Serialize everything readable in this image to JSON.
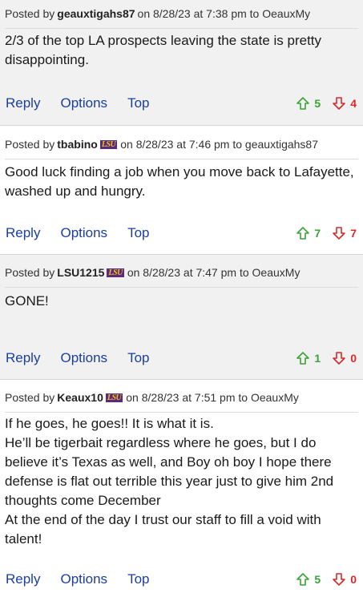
{
  "labels": {
    "posted_by": "Posted by",
    "on": "on",
    "to": "to"
  },
  "posts": [
    {
      "user": "geauxtigahs87",
      "badge": "",
      "date": "8/28/23",
      "time": "at 7:38 pm",
      "to_user": "OeauxMy",
      "lines": [
        "2/3 of the top LA prospects leaving the state is pretty disappointing."
      ],
      "reply": "Reply",
      "options": "Options",
      "top": "Top",
      "upvotes": "5",
      "downvotes": "4"
    },
    {
      "user": "tbabino",
      "badge": "LSU",
      "date": "8/28/23",
      "time": "at 7:46 pm",
      "to_user": "geauxtigahs87",
      "lines": [
        "Good luck finding a job when you move back to Lafayette, washed up and hungry."
      ],
      "reply": "Reply",
      "options": "Options",
      "top": "Top",
      "upvotes": "7",
      "downvotes": "7"
    },
    {
      "user": "LSU1215",
      "badge": "LSU",
      "date": "8/28/23",
      "time": "at 7:47 pm",
      "to_user": "OeauxMy",
      "lines": [
        "GONE!"
      ],
      "reply": "Reply",
      "options": "Options",
      "top": "Top",
      "upvotes": "1",
      "downvotes": "0"
    },
    {
      "user": "Keaux10",
      "badge": "LSU",
      "date": "8/28/23",
      "time": "at 7:51 pm",
      "to_user": "OeauxMy",
      "lines": [
        "If he goes, he goes!! It is what it is.",
        "He’ll be tigerbait regardless where he goes, but I do believe it’s Texas as well, and Boy oh boy I hope there defense is flat out terrible this year just to give him 2nd thoughts come December",
        "At the end of the day I trust our staff to fill a void with talent!"
      ],
      "reply": "Reply",
      "options": "Options",
      "top": "Top",
      "upvotes": "5",
      "downvotes": "0"
    }
  ],
  "colors": {
    "link": "#1a3fa0",
    "upvote": "#3aa335",
    "downvote": "#d62a2a",
    "badge_bg": "#5a2a82",
    "badge_fg": "#f5c400"
  },
  "icons": {
    "upvote": "arrow-up-icon",
    "downvote": "arrow-down-icon",
    "badge": "lsu-badge-icon"
  }
}
